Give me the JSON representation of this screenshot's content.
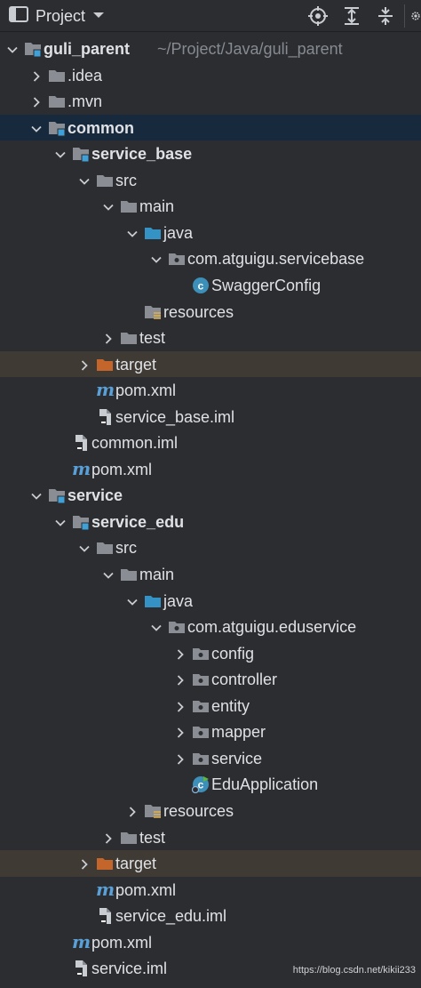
{
  "toolbar": {
    "title": "Project",
    "icons": [
      "window-icon",
      "chevron-down-icon",
      "locate-icon",
      "expand-all-icon",
      "collapse-all-icon",
      "settings-icon"
    ]
  },
  "tree": [
    {
      "label": "guli_parent",
      "path": "~/Project/Java/guli_parent",
      "bold": true,
      "depth": 0,
      "arrow": "down",
      "icon": "module-folder"
    },
    {
      "label": ".idea",
      "depth": 1,
      "arrow": "right",
      "icon": "folder"
    },
    {
      "label": ".mvn",
      "depth": 1,
      "arrow": "right",
      "icon": "folder"
    },
    {
      "label": "common",
      "bold": true,
      "depth": 1,
      "arrow": "down",
      "icon": "module-folder",
      "state": "sel"
    },
    {
      "label": "service_base",
      "bold": true,
      "depth": 2,
      "arrow": "down",
      "icon": "module-folder"
    },
    {
      "label": "src",
      "depth": 3,
      "arrow": "down",
      "icon": "folder"
    },
    {
      "label": "main",
      "depth": 4,
      "arrow": "down",
      "icon": "folder"
    },
    {
      "label": "java",
      "depth": 5,
      "arrow": "down",
      "icon": "source-folder"
    },
    {
      "label": "com.atguigu.servicebase",
      "depth": 6,
      "arrow": "down",
      "icon": "package"
    },
    {
      "label": "SwaggerConfig",
      "depth": 7,
      "arrow": "none",
      "icon": "class"
    },
    {
      "label": "resources",
      "depth": 5,
      "arrow": "none",
      "icon": "resources-folder"
    },
    {
      "label": "test",
      "depth": 4,
      "arrow": "right",
      "icon": "folder"
    },
    {
      "label": "target",
      "depth": 3,
      "arrow": "right",
      "icon": "excluded-folder",
      "state": "excl"
    },
    {
      "label": "pom.xml",
      "depth": 3,
      "arrow": "none",
      "icon": "maven"
    },
    {
      "label": "service_base.iml",
      "depth": 3,
      "arrow": "none",
      "icon": "iml"
    },
    {
      "label": "common.iml",
      "depth": 2,
      "arrow": "none",
      "icon": "iml"
    },
    {
      "label": "pom.xml",
      "depth": 2,
      "arrow": "none",
      "icon": "maven"
    },
    {
      "label": "service",
      "bold": true,
      "depth": 1,
      "arrow": "down",
      "icon": "module-folder"
    },
    {
      "label": "service_edu",
      "bold": true,
      "depth": 2,
      "arrow": "down",
      "icon": "module-folder"
    },
    {
      "label": "src",
      "depth": 3,
      "arrow": "down",
      "icon": "folder"
    },
    {
      "label": "main",
      "depth": 4,
      "arrow": "down",
      "icon": "folder"
    },
    {
      "label": "java",
      "depth": 5,
      "arrow": "down",
      "icon": "source-folder"
    },
    {
      "label": "com.atguigu.eduservice",
      "depth": 6,
      "arrow": "down",
      "icon": "package"
    },
    {
      "label": "config",
      "depth": 7,
      "arrow": "right",
      "icon": "package"
    },
    {
      "label": "controller",
      "depth": 7,
      "arrow": "right",
      "icon": "package"
    },
    {
      "label": "entity",
      "depth": 7,
      "arrow": "right",
      "icon": "package"
    },
    {
      "label": "mapper",
      "depth": 7,
      "arrow": "right",
      "icon": "package"
    },
    {
      "label": "service",
      "depth": 7,
      "arrow": "right",
      "icon": "package"
    },
    {
      "label": "EduApplication",
      "depth": 7,
      "arrow": "none",
      "icon": "spring-class"
    },
    {
      "label": "resources",
      "depth": 5,
      "arrow": "right",
      "icon": "resources-folder"
    },
    {
      "label": "test",
      "depth": 4,
      "arrow": "right",
      "icon": "folder"
    },
    {
      "label": "target",
      "depth": 3,
      "arrow": "right",
      "icon": "excluded-folder",
      "state": "excl"
    },
    {
      "label": "pom.xml",
      "depth": 3,
      "arrow": "none",
      "icon": "maven"
    },
    {
      "label": "service_edu.iml",
      "depth": 3,
      "arrow": "none",
      "icon": "iml"
    },
    {
      "label": "pom.xml",
      "depth": 2,
      "arrow": "none",
      "icon": "maven"
    },
    {
      "label": "service.iml",
      "depth": 2,
      "arrow": "none",
      "icon": "iml"
    }
  ],
  "watermark": "https://blog.csdn.net/kikii233",
  "colors": {
    "background": "#2b2d30",
    "selected": "#17293d",
    "excluded": "#3f3a33",
    "folder": "#8a8e94",
    "source_folder": "#3592c4",
    "excluded_folder": "#c4652b",
    "module_badge": "#3fa1d8",
    "maven": "#5aa0d8",
    "class_icon": "#3c8fb8"
  }
}
